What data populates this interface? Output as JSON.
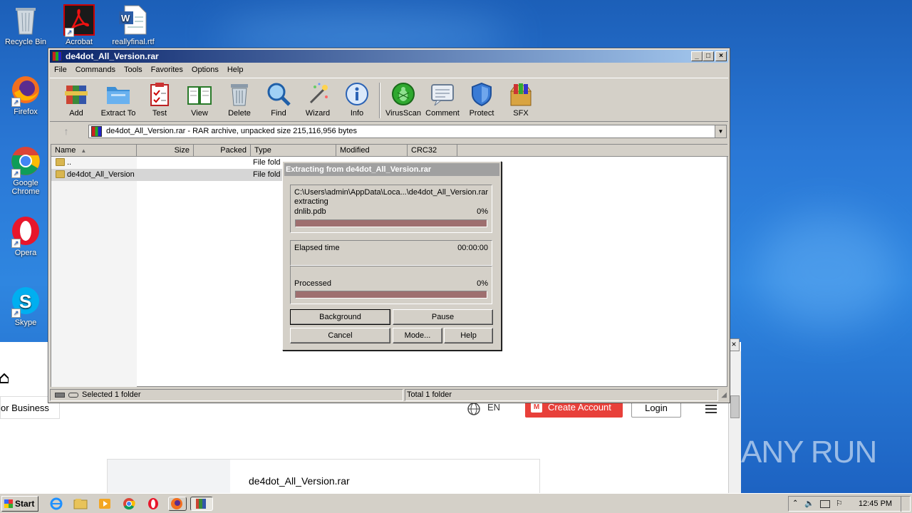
{
  "desktop": {
    "icons": [
      {
        "label": "Recycle Bin"
      },
      {
        "label": "Acrobat"
      },
      {
        "label": "reallyfinal.rtf"
      },
      {
        "label": "Firefox"
      },
      {
        "label": "Google Chrome"
      },
      {
        "label": "Opera"
      },
      {
        "label": "Skype"
      }
    ],
    "watermark": "ANY RUN"
  },
  "background_page": {
    "business_text": "or Business",
    "language": "EN",
    "create_account": "Create Account",
    "login": "Login",
    "file_title": "de4dot_All_Version.rar"
  },
  "winrar": {
    "title": "de4dot_All_Version.rar",
    "menu": [
      "File",
      "Commands",
      "Tools",
      "Favorites",
      "Options",
      "Help"
    ],
    "toolbar": [
      {
        "label": "Add",
        "icon": "add-archive-icon"
      },
      {
        "label": "Extract To",
        "icon": "extract-folder-icon"
      },
      {
        "label": "Test",
        "icon": "test-clipboard-icon"
      },
      {
        "label": "View",
        "icon": "view-book-icon"
      },
      {
        "label": "Delete",
        "icon": "trash-icon"
      },
      {
        "label": "Find",
        "icon": "magnifier-icon"
      },
      {
        "label": "Wizard",
        "icon": "magic-wand-icon"
      },
      {
        "label": "Info",
        "icon": "info-icon"
      },
      {
        "label": "VirusScan",
        "icon": "virus-scan-icon"
      },
      {
        "label": "Comment",
        "icon": "comment-icon"
      },
      {
        "label": "Protect",
        "icon": "shield-icon"
      },
      {
        "label": "SFX",
        "icon": "sfx-box-icon"
      }
    ],
    "address": "de4dot_All_Version.rar - RAR archive, unpacked size 215,116,956 bytes",
    "columns": [
      "Name",
      "Size",
      "Packed",
      "Type",
      "Modified",
      "CRC32"
    ],
    "rows": [
      {
        "name": "..",
        "type": "File fold"
      },
      {
        "name": "de4dot_All_Version",
        "type": "File fold"
      }
    ],
    "status_left": "Selected 1 folder",
    "status_right": "Total 1 folder"
  },
  "extract_dialog": {
    "title": "Extracting from de4dot_All_Version.rar",
    "path": "C:\\Users\\admin\\AppData\\Loca...\\de4dot_All_Version.rar",
    "action": "extracting",
    "file": "dnlib.pdb",
    "file_percent": "0%",
    "file_progress": 0,
    "elapsed_label": "Elapsed time",
    "elapsed_value": "00:00:00",
    "processed_label": "Processed",
    "processed_percent": "0%",
    "processed_progress": 0,
    "buttons": {
      "background": "Background",
      "pause": "Pause",
      "cancel": "Cancel",
      "mode": "Mode...",
      "help": "Help"
    }
  },
  "taskbar": {
    "start": "Start",
    "clock": "12:45 PM"
  }
}
